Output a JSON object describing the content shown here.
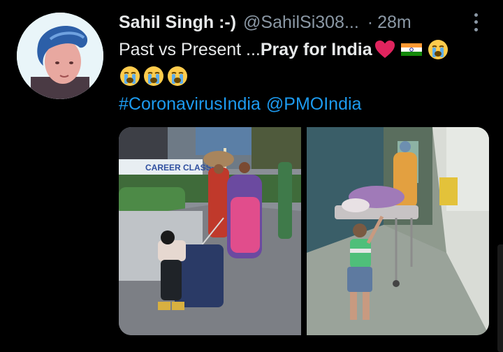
{
  "tweet": {
    "display_name": "Sahil Singh :-)",
    "handle": "@SahilSi308...",
    "separator": "·",
    "timestamp": "28m",
    "line1_prefix": "Past vs Present ...",
    "line1_bold": "Pray for India",
    "hashtag": "#CoronavirusIndia",
    "mention": "@PMOIndia"
  },
  "icons": {
    "heart": "red-heart-icon",
    "flag": "india-flag-icon",
    "crying": "loudly-crying-face-icon",
    "more": "more-options-icon"
  },
  "photos": {
    "left_sign_text": "CAREER CLASSES"
  },
  "colors": {
    "background": "#000000",
    "text": "#e7e9ea",
    "secondary": "#8b98a5",
    "link": "#1d9bf0",
    "heart": "#e0245e"
  }
}
